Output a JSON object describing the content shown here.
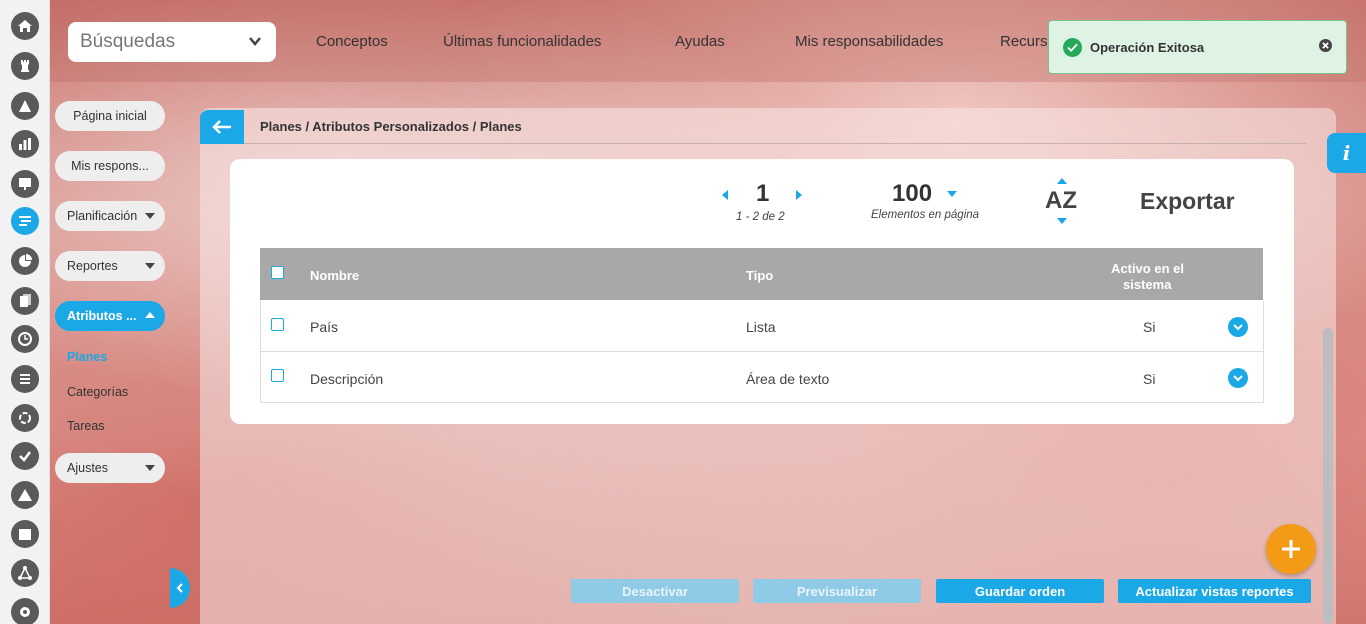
{
  "topbar": {
    "search_label": "Búsquedas",
    "nav": [
      "Conceptos",
      "Últimas funcionalidades",
      "Ayudas",
      "Mis responsabilidades",
      "Recurs"
    ]
  },
  "toast": {
    "message": "Operación Exitosa"
  },
  "sidebar": {
    "items": [
      {
        "label": "Página inicial"
      },
      {
        "label": "Mis respons..."
      },
      {
        "label": "Planificación"
      },
      {
        "label": "Reportes"
      },
      {
        "label": "Atributos ..."
      },
      {
        "label": "Ajustes"
      }
    ],
    "subitems": [
      "Planes",
      "Categorías",
      "Tareas"
    ]
  },
  "breadcrumb": "Planes / Atributos Personalizados / Planes",
  "pager": {
    "page": "1",
    "range": "1 - 2 de 2",
    "per_page": "100",
    "per_page_label": "Elementos en página",
    "sort_label": "AZ",
    "export_label": "Exportar"
  },
  "table": {
    "headers": {
      "name": "Nombre",
      "type": "Tipo",
      "active_1": "Activo en el",
      "active_2": "sistema"
    },
    "rows": [
      {
        "name": "País",
        "type": "Lista",
        "active": "Si"
      },
      {
        "name": "Descripción",
        "type": "Área de texto",
        "active": "Si"
      }
    ]
  },
  "buttons": {
    "deactivate": "Desactivar",
    "preview": "Previsualizar",
    "save_order": "Guardar orden",
    "update_views": "Actualizar vistas reportes"
  },
  "info_label": "i",
  "colors": {
    "accent": "#1aa8e6",
    "fab": "#f39a16",
    "success": "#26a95b"
  }
}
